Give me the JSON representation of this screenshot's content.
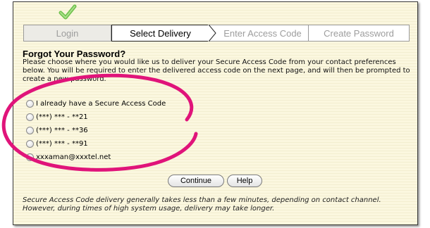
{
  "wizard": {
    "steps": [
      {
        "label": "Login",
        "state": "completed"
      },
      {
        "label": "Select Delivery",
        "state": "current"
      },
      {
        "label": "Enter Access Code",
        "state": "upcoming"
      },
      {
        "label": "Create Password",
        "state": "upcoming"
      }
    ],
    "completed_icon": "checkmark-icon"
  },
  "page": {
    "title": "Forgot Your Password?",
    "instructions": "Please choose where you would like us to deliver your Secure Access Code from your contact preferences below. You will be required to enter the delivered access code on the next page, and will then be prompted to create a new password."
  },
  "options": [
    {
      "label": "I already have a Secure Access Code",
      "selected": false
    },
    {
      "label": "(***) *** - **21",
      "selected": false
    },
    {
      "label": "(***) *** - **36",
      "selected": false
    },
    {
      "label": "(***) *** - **91",
      "selected": false
    },
    {
      "label": "xxxaman@xxxtel.net",
      "selected": false
    }
  ],
  "buttons": {
    "continue": "Continue",
    "help": "Help"
  },
  "footer": "Secure Access Code delivery generally takes less than a few minutes, depending on contact channel. However, during times of high system usage, delivery may take longer.",
  "colors": {
    "panel_bg": "#fbf7df",
    "highlight_ellipse": "#e0147a",
    "check_green": "#6cc04a"
  }
}
